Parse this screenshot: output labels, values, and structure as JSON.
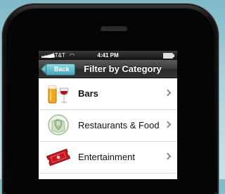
{
  "status_bar": {
    "carrier": "AT&T",
    "time": "4:41 PM"
  },
  "nav": {
    "back_label": "Back",
    "title": "Filter by Category"
  },
  "categories": [
    {
      "label": "Bars",
      "icon": "beer-and-wine-icon"
    },
    {
      "label": "Restaurants & Food",
      "icon": "restaurant-map-pin-icon"
    },
    {
      "label": "Entertainment",
      "icon": "ticket-icon"
    }
  ],
  "colors": {
    "back_button": "#4aa3b9",
    "nav_bar": "#333333",
    "background": "#a9d3dc"
  }
}
